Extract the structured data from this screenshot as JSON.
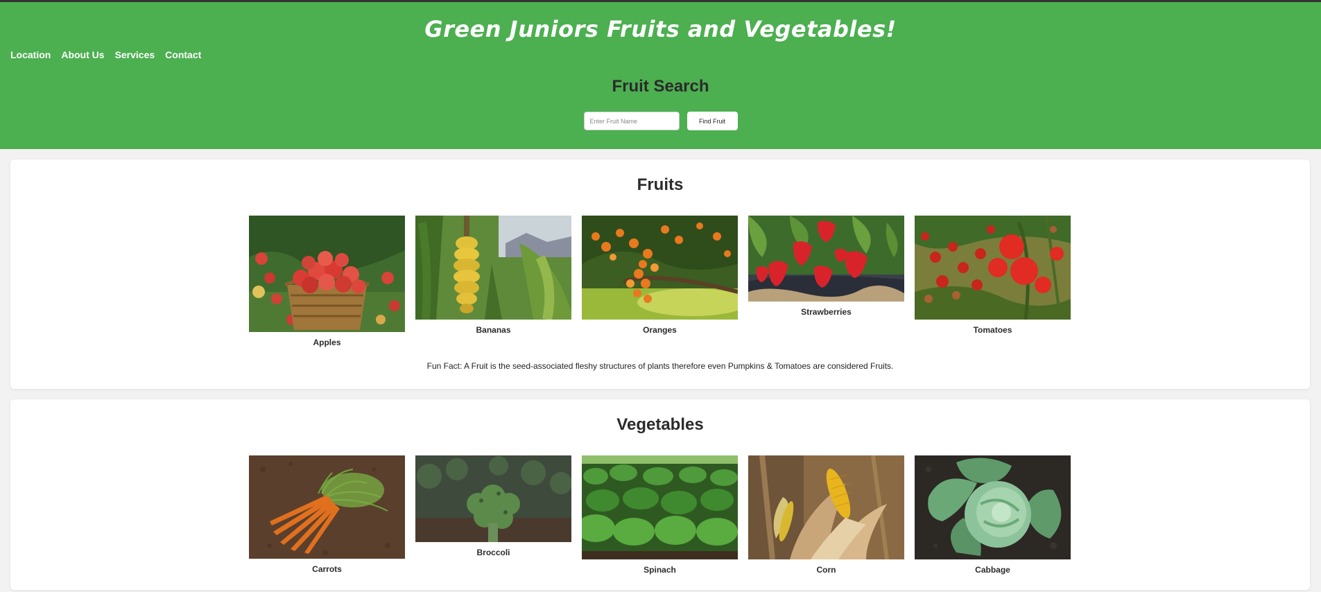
{
  "header": {
    "title": "Green Juniors Fruits and Vegetables!",
    "nav": [
      "Location",
      "About Us",
      "Services",
      "Contact"
    ],
    "search_title": "Fruit Search",
    "search_placeholder": "Enter Fruit Name",
    "search_button": "Find Fruit",
    "bg_color": "#4caf50"
  },
  "fruits": {
    "title": "Fruits",
    "items": [
      {
        "label": "Apples",
        "icon": "apples-photo"
      },
      {
        "label": "Bananas",
        "icon": "bananas-photo"
      },
      {
        "label": "Oranges",
        "icon": "oranges-photo"
      },
      {
        "label": "Strawberries",
        "icon": "strawberries-photo"
      },
      {
        "label": "Tomatoes",
        "icon": "tomatoes-photo"
      }
    ],
    "fun_fact": "Fun Fact: A Fruit is the seed-associated fleshy structures of plants therefore even Pumpkins & Tomatoes are considered Fruits."
  },
  "vegetables": {
    "title": "Vegetables",
    "items": [
      {
        "label": "Carrots",
        "icon": "carrots-photo"
      },
      {
        "label": "Broccoli",
        "icon": "broccoli-photo"
      },
      {
        "label": "Spinach",
        "icon": "spinach-photo"
      },
      {
        "label": "Corn",
        "icon": "corn-photo"
      },
      {
        "label": "Cabbage",
        "icon": "cabbage-photo"
      }
    ]
  }
}
